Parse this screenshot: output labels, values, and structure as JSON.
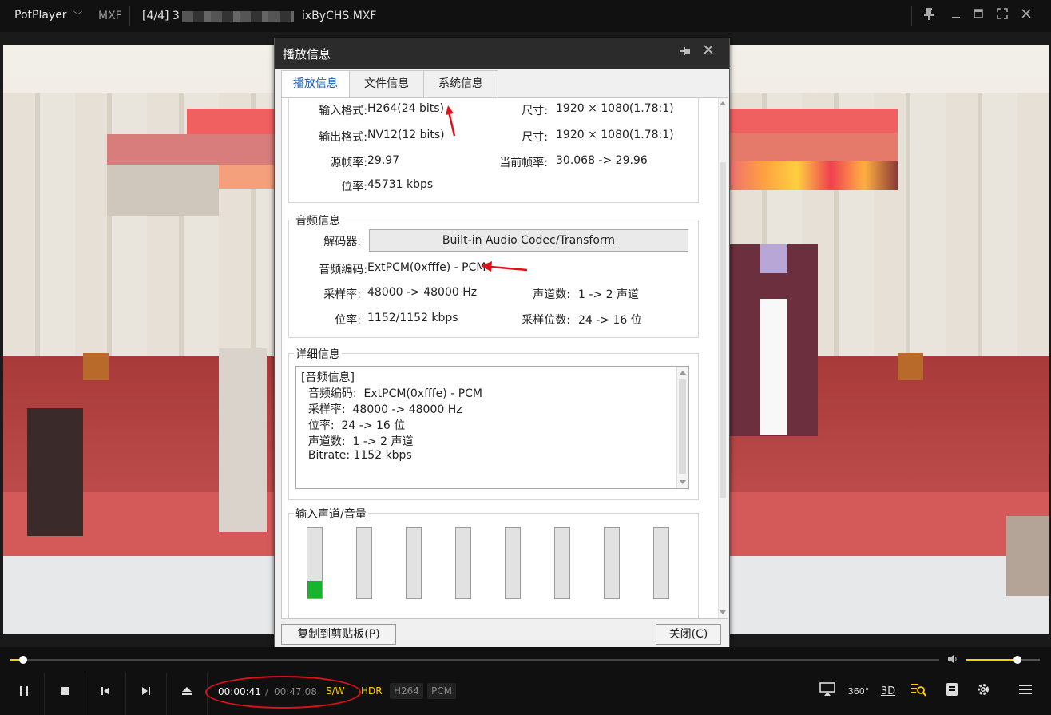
{
  "titlebar": {
    "app_name": "PotPlayer",
    "format": "MXF",
    "file_prefix": "[4/4] 3",
    "file_suffix": "ixByCHS.MXF"
  },
  "dialog": {
    "title": "播放信息",
    "tabs": [
      {
        "label": "播放信息",
        "active": true
      },
      {
        "label": "文件信息",
        "active": false
      },
      {
        "label": "系统信息",
        "active": false
      }
    ],
    "video": {
      "input_format_label": "输入格式:",
      "input_format_value": "H264(24 bits)",
      "size_label_1": "尺寸:",
      "size_value_1": "1920 × 1080(1.78:1)",
      "output_format_label": "输出格式:",
      "output_format_value": "NV12(12 bits)",
      "size_label_2": "尺寸:",
      "size_value_2": "1920 × 1080(1.78:1)",
      "source_fps_label": "源帧率:",
      "source_fps_value": "29.97",
      "current_fps_label": "当前帧率:",
      "current_fps_value": "30.068 -> 29.96",
      "bitrate_label": "位率:",
      "bitrate_value": "45731 kbps"
    },
    "audio": {
      "group_title": "音频信息",
      "decoder_label": "解码器:",
      "decoder_value": "Built-in Audio Codec/Transform",
      "codec_label": "音频编码:",
      "codec_value": "ExtPCM(0xfffe) - PCM",
      "samplerate_label": "采样率:",
      "samplerate_value": "48000 -> 48000 Hz",
      "channels_label": "声道数:",
      "channels_value": "1 -> 2 声道",
      "bitrate_label": "位率:",
      "bitrate_value": "1152/1152 kbps",
      "bits_label": "采样位数:",
      "bits_value": "24 -> 16 位"
    },
    "detail": {
      "group_title": "详细信息",
      "lines": [
        "[音频信息]",
        "  音频编码:  ExtPCM(0xfffe) - PCM",
        "  采样率:  48000 -> 48000 Hz",
        "  位率:  24 -> 16 位",
        "  声道数:  1 -> 2 声道",
        "  Bitrate: 1152 kbps"
      ]
    },
    "meters": {
      "group_title": "输入声道/音量",
      "levels": [
        0.25,
        0,
        0,
        0,
        0,
        0,
        0,
        0
      ]
    },
    "copy_button": "复制到剪贴板(P)",
    "close_button": "关闭(C)"
  },
  "controls": {
    "current_time": "00:00:41",
    "time_sep": "/",
    "total_time": "00:47:08",
    "tags": [
      "S/W",
      "HDR",
      "H264",
      "PCM"
    ],
    "seek_progress": 0.0145,
    "volume": 0.7,
    "icon_360": "360°",
    "icon_3d": "3D"
  },
  "colors": {
    "accent": "#ffd000",
    "annotation_red": "#e0101a",
    "meter_green": "#17b52e",
    "active_tab": "#1a5fb4"
  }
}
